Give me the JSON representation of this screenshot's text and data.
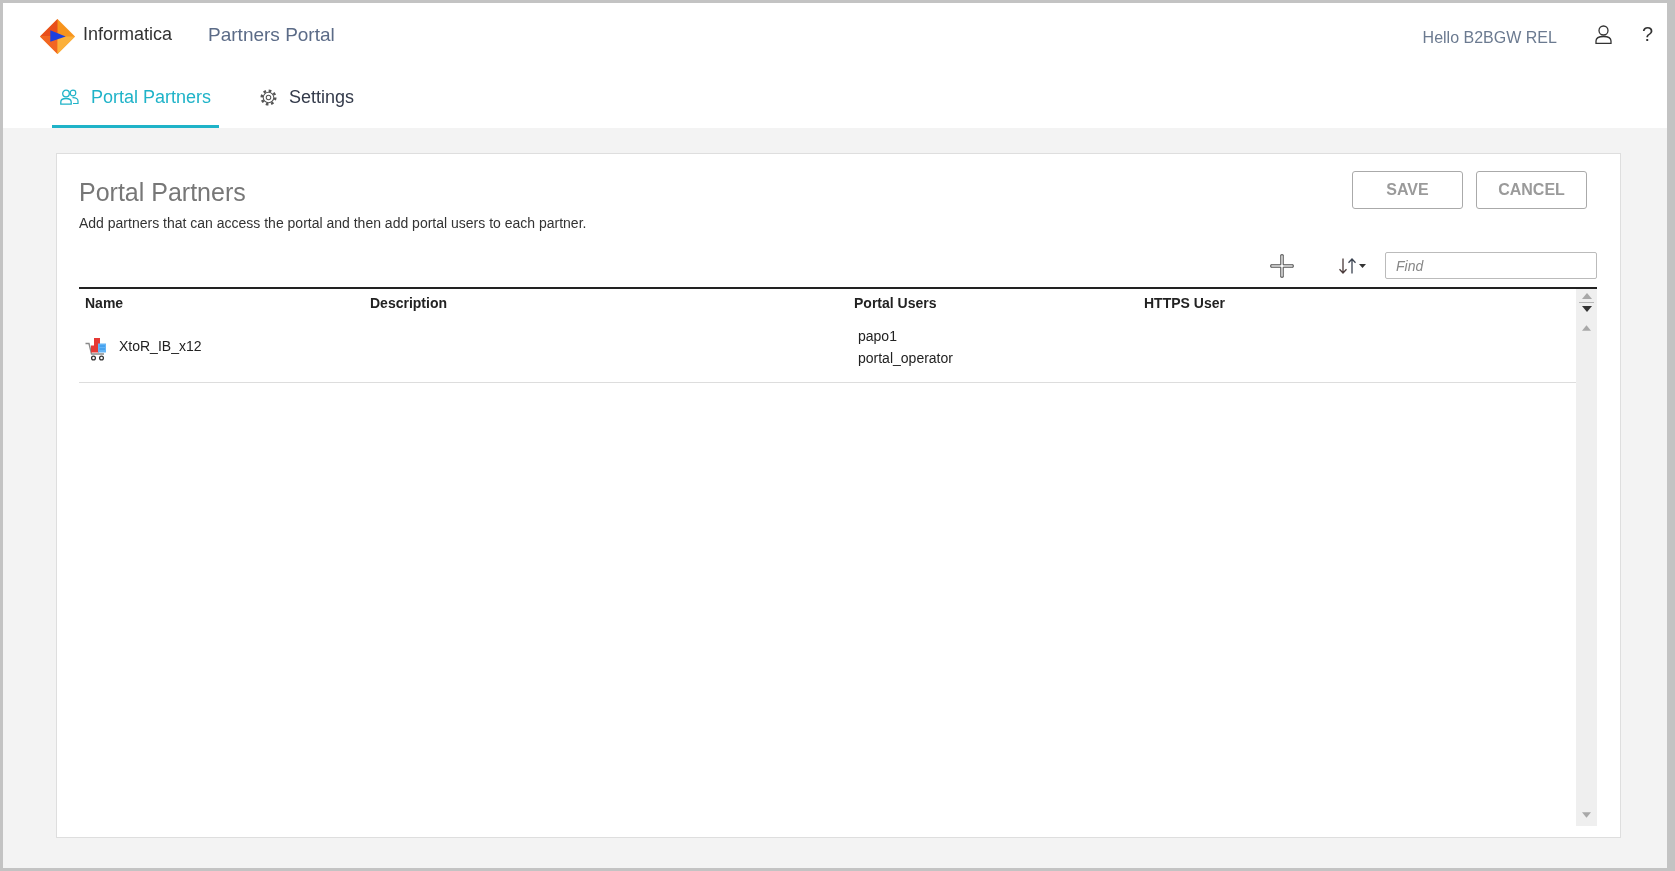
{
  "header": {
    "brand": "Informatica",
    "app_title": "Partners Portal",
    "greeting": "Hello B2BGW REL",
    "help": "?"
  },
  "tabs": [
    {
      "label": "Portal Partners",
      "kind": "people",
      "selected": true
    },
    {
      "label": "Settings",
      "kind": "gear",
      "selected": false
    }
  ],
  "panel": {
    "title": "Portal Partners",
    "description": "Add partners that can access the portal and then add portal users to each partner.",
    "buttons": [
      "SAVE",
      "CANCEL"
    ],
    "find": {
      "placeholder": "Find"
    }
  },
  "table": {
    "columns": [
      "Name",
      "Description",
      "Portal Users",
      "HTTPS User"
    ],
    "rows": [
      {
        "name": "XtoR_IB_x12",
        "portal_users": [
          "papo1",
          "portal_operator"
        ]
      }
    ]
  }
}
